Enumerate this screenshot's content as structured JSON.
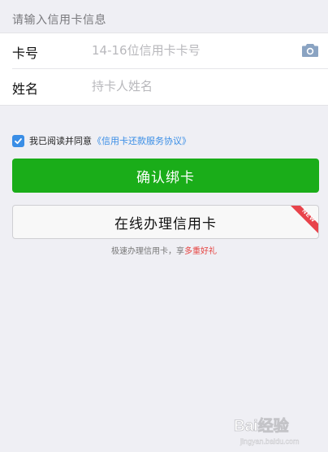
{
  "section_header": "请输入信用卡信息",
  "form": {
    "card_number": {
      "label": "卡号",
      "placeholder": "14-16位信用卡卡号",
      "value": ""
    },
    "name": {
      "label": "姓名",
      "placeholder": "持卡人姓名",
      "value": ""
    }
  },
  "agreement": {
    "checked": true,
    "text": "我已阅读并同意",
    "link": "《信用卡还款服务协议》"
  },
  "buttons": {
    "confirm": "确认绑卡",
    "apply": "在线办理信用卡",
    "new_badge": "NEW"
  },
  "promo": {
    "text": "极速办理信用卡，享",
    "highlight": "多重好礼"
  },
  "watermark": {
    "text": "Bai经验",
    "sub": "jingyan.baidu.com"
  },
  "colors": {
    "background": "#efeff4",
    "primary": "#1aad19",
    "link": "#3a8ee6",
    "badge": "#e8434b",
    "highlight": "#e64340"
  }
}
